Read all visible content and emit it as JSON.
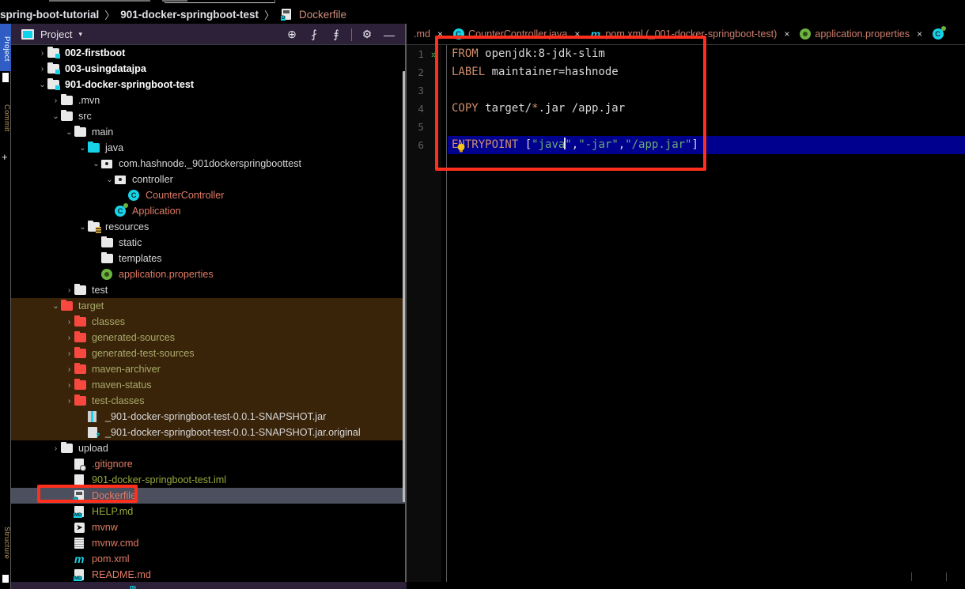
{
  "breadcrumb": {
    "items": [
      {
        "label": "spring-boot-tutorial",
        "style": "bold"
      },
      {
        "label": "901-docker-springboot-test",
        "style": "bold"
      },
      {
        "label": "Dockerfile",
        "style": "file"
      }
    ],
    "separator": "〉"
  },
  "left_strip": {
    "project_label": "Project",
    "commit_label": "Commit",
    "structure_label": "Structure",
    "plus_label": "+"
  },
  "project_panel": {
    "title": "Project",
    "caret": "▾",
    "toolbar": [
      {
        "name": "select-opened-file-icon",
        "glyph": "⊕"
      },
      {
        "name": "expand-all-icon",
        "glyph": "⨏"
      },
      {
        "name": "collapse-all-icon",
        "glyph": "⨎"
      },
      {
        "name": "settings-gear-icon",
        "glyph": "⚙"
      },
      {
        "name": "hide-icon",
        "glyph": "—"
      }
    ],
    "tree": [
      {
        "label": "002-firstboot",
        "indent": 1,
        "arrow": "›",
        "icon": "module-folder",
        "color": "white"
      },
      {
        "label": "003-usingdatajpa",
        "indent": 1,
        "arrow": "›",
        "icon": "module-folder",
        "color": "white"
      },
      {
        "label": "901-docker-springboot-test",
        "indent": 1,
        "arrow": "⌄",
        "icon": "module-folder",
        "color": "white"
      },
      {
        "label": ".mvn",
        "indent": 2,
        "arrow": "›",
        "icon": "folder",
        "color": "plain"
      },
      {
        "label": "src",
        "indent": 2,
        "arrow": "⌄",
        "icon": "folder",
        "color": "plain"
      },
      {
        "label": "main",
        "indent": 3,
        "arrow": "⌄",
        "icon": "folder",
        "color": "plain"
      },
      {
        "label": "java",
        "indent": 4,
        "arrow": "⌄",
        "icon": "folder-cyan",
        "color": "plain"
      },
      {
        "label": "com.hashnode._901dockerspringboottest",
        "indent": 5,
        "arrow": "⌄",
        "icon": "package",
        "color": "plain"
      },
      {
        "label": "controller",
        "indent": 6,
        "arrow": "⌄",
        "icon": "package",
        "color": "plain"
      },
      {
        "label": "CounterController",
        "indent": 7,
        "arrow": "",
        "icon": "class",
        "color": "rose"
      },
      {
        "label": "Application",
        "indent": 6,
        "arrow": "",
        "icon": "spring-class",
        "color": "rose"
      },
      {
        "label": "resources",
        "indent": 4,
        "arrow": "⌄",
        "icon": "folder-res",
        "color": "plain"
      },
      {
        "label": "static",
        "indent": 5,
        "arrow": "",
        "icon": "folder",
        "color": "plain"
      },
      {
        "label": "templates",
        "indent": 5,
        "arrow": "",
        "icon": "folder",
        "color": "plain"
      },
      {
        "label": "application.properties",
        "indent": 5,
        "arrow": "",
        "icon": "spring",
        "color": "rose"
      },
      {
        "label": "test",
        "indent": 3,
        "arrow": "›",
        "icon": "folder",
        "color": "plain"
      },
      {
        "label": "target",
        "indent": 2,
        "arrow": "⌄",
        "icon": "folder-red",
        "color": "target",
        "band": true
      },
      {
        "label": "classes",
        "indent": 3,
        "arrow": "›",
        "icon": "folder-red",
        "color": "target",
        "band": true
      },
      {
        "label": "generated-sources",
        "indent": 3,
        "arrow": "›",
        "icon": "folder-red",
        "color": "target",
        "band": true
      },
      {
        "label": "generated-test-sources",
        "indent": 3,
        "arrow": "›",
        "icon": "folder-red",
        "color": "target",
        "band": true
      },
      {
        "label": "maven-archiver",
        "indent": 3,
        "arrow": "›",
        "icon": "folder-red",
        "color": "target",
        "band": true
      },
      {
        "label": "maven-status",
        "indent": 3,
        "arrow": "›",
        "icon": "folder-red",
        "color": "target",
        "band": true
      },
      {
        "label": "test-classes",
        "indent": 3,
        "arrow": "›",
        "icon": "folder-red",
        "color": "target",
        "band": true
      },
      {
        "label": "_901-docker-springboot-test-0.0.1-SNAPSHOT.jar",
        "indent": 4,
        "arrow": "",
        "icon": "jar",
        "color": "plain",
        "band": true
      },
      {
        "label": "_901-docker-springboot-test-0.0.1-SNAPSHOT.jar.original",
        "indent": 4,
        "arrow": "",
        "icon": "jar-orig",
        "color": "plain",
        "band": true
      },
      {
        "label": "upload",
        "indent": 2,
        "arrow": "›",
        "icon": "folder",
        "color": "plain"
      },
      {
        "label": ".gitignore",
        "indent": 3,
        "arrow": "",
        "icon": "gitignore",
        "color": "rose"
      },
      {
        "label": "901-docker-springboot-test.iml",
        "indent": 3,
        "arrow": "",
        "icon": "iml",
        "color": "green"
      },
      {
        "label": "Dockerfile",
        "indent": 3,
        "arrow": "",
        "icon": "docker",
        "color": "rose",
        "selected": true
      },
      {
        "label": "HELP.md",
        "indent": 3,
        "arrow": "",
        "icon": "md",
        "color": "green"
      },
      {
        "label": "mvnw",
        "indent": 3,
        "arrow": "",
        "icon": "script",
        "color": "rose"
      },
      {
        "label": "mvnw.cmd",
        "indent": 3,
        "arrow": "",
        "icon": "cmd",
        "color": "rose"
      },
      {
        "label": "pom.xml",
        "indent": 3,
        "arrow": "",
        "icon": "maven",
        "color": "rose"
      },
      {
        "label": "README.md",
        "indent": 3,
        "arrow": "",
        "icon": "md",
        "color": "rose"
      }
    ]
  },
  "editor": {
    "tabs": [
      {
        "label": ".md",
        "icon": "md-icon",
        "close": "×",
        "truncated_left": true
      },
      {
        "label": "CounterController.java",
        "icon": "class-icon",
        "close": "×"
      },
      {
        "label": "pom.xml (_001-docker-springboot-test)",
        "icon": "maven-icon",
        "close": "×"
      },
      {
        "label": "application.properties",
        "icon": "spring-icon",
        "close": "×"
      },
      {
        "label": "",
        "icon": "spring-class-icon",
        "close": ""
      }
    ],
    "gutter_lines": [
      "1",
      "2",
      "3",
      "4",
      "5",
      "6"
    ],
    "run_marker": "»",
    "intention_bulb": "💡",
    "lines": [
      {
        "n": 1,
        "tokens": [
          {
            "t": "FROM",
            "c": "kw"
          },
          {
            "t": " openjdk:8-jdk-slim",
            "c": "txt"
          }
        ]
      },
      {
        "n": 2,
        "tokens": [
          {
            "t": "LABEL",
            "c": "kw"
          },
          {
            "t": " maintainer=hashnode",
            "c": "txt"
          }
        ]
      },
      {
        "n": 3,
        "tokens": []
      },
      {
        "n": 4,
        "tokens": [
          {
            "t": "COPY",
            "c": "kw"
          },
          {
            "t": " target/",
            "c": "txt"
          },
          {
            "t": "*",
            "c": "kw"
          },
          {
            "t": ".jar /app.jar",
            "c": "txt"
          }
        ]
      },
      {
        "n": 5,
        "tokens": []
      },
      {
        "n": 6,
        "tokens": [
          {
            "t": "ENTRYPOINT",
            "c": "kw"
          },
          {
            "t": " [",
            "c": "txt"
          },
          {
            "t": "\"java\"",
            "c": "str"
          },
          {
            "t": ",",
            "c": "txt"
          },
          {
            "t": "\"-jar\"",
            "c": "str"
          },
          {
            "t": ",",
            "c": "txt"
          },
          {
            "t": "\"/app.jar\"",
            "c": "str"
          },
          {
            "t": "]",
            "c": "txt"
          }
        ],
        "selected": true,
        "caret_after_char": 17
      }
    ],
    "full_text": "FROM openjdk:8-jdk-slim\nLABEL maintainer=hashnode\n\nCOPY target/*.jar /app.jar\n\nENTRYPOINT [\"java\",\"-jar\",\"/app.jar\"]"
  },
  "annotations": [
    {
      "name": "code-highlight-box",
      "color": "#ff2f1e"
    },
    {
      "name": "dockerfile-tree-highlight-box",
      "color": "#ff2f1e"
    }
  ],
  "colors": {
    "accent_cyan": "#16d3e8",
    "keyword_orange": "#cf8e6d",
    "string_green": "#6aab73",
    "selection_blue": "#00008f",
    "target_band": "#3a2409",
    "panel_header": "#2d2139",
    "annotation_red": "#ff2f1e"
  }
}
